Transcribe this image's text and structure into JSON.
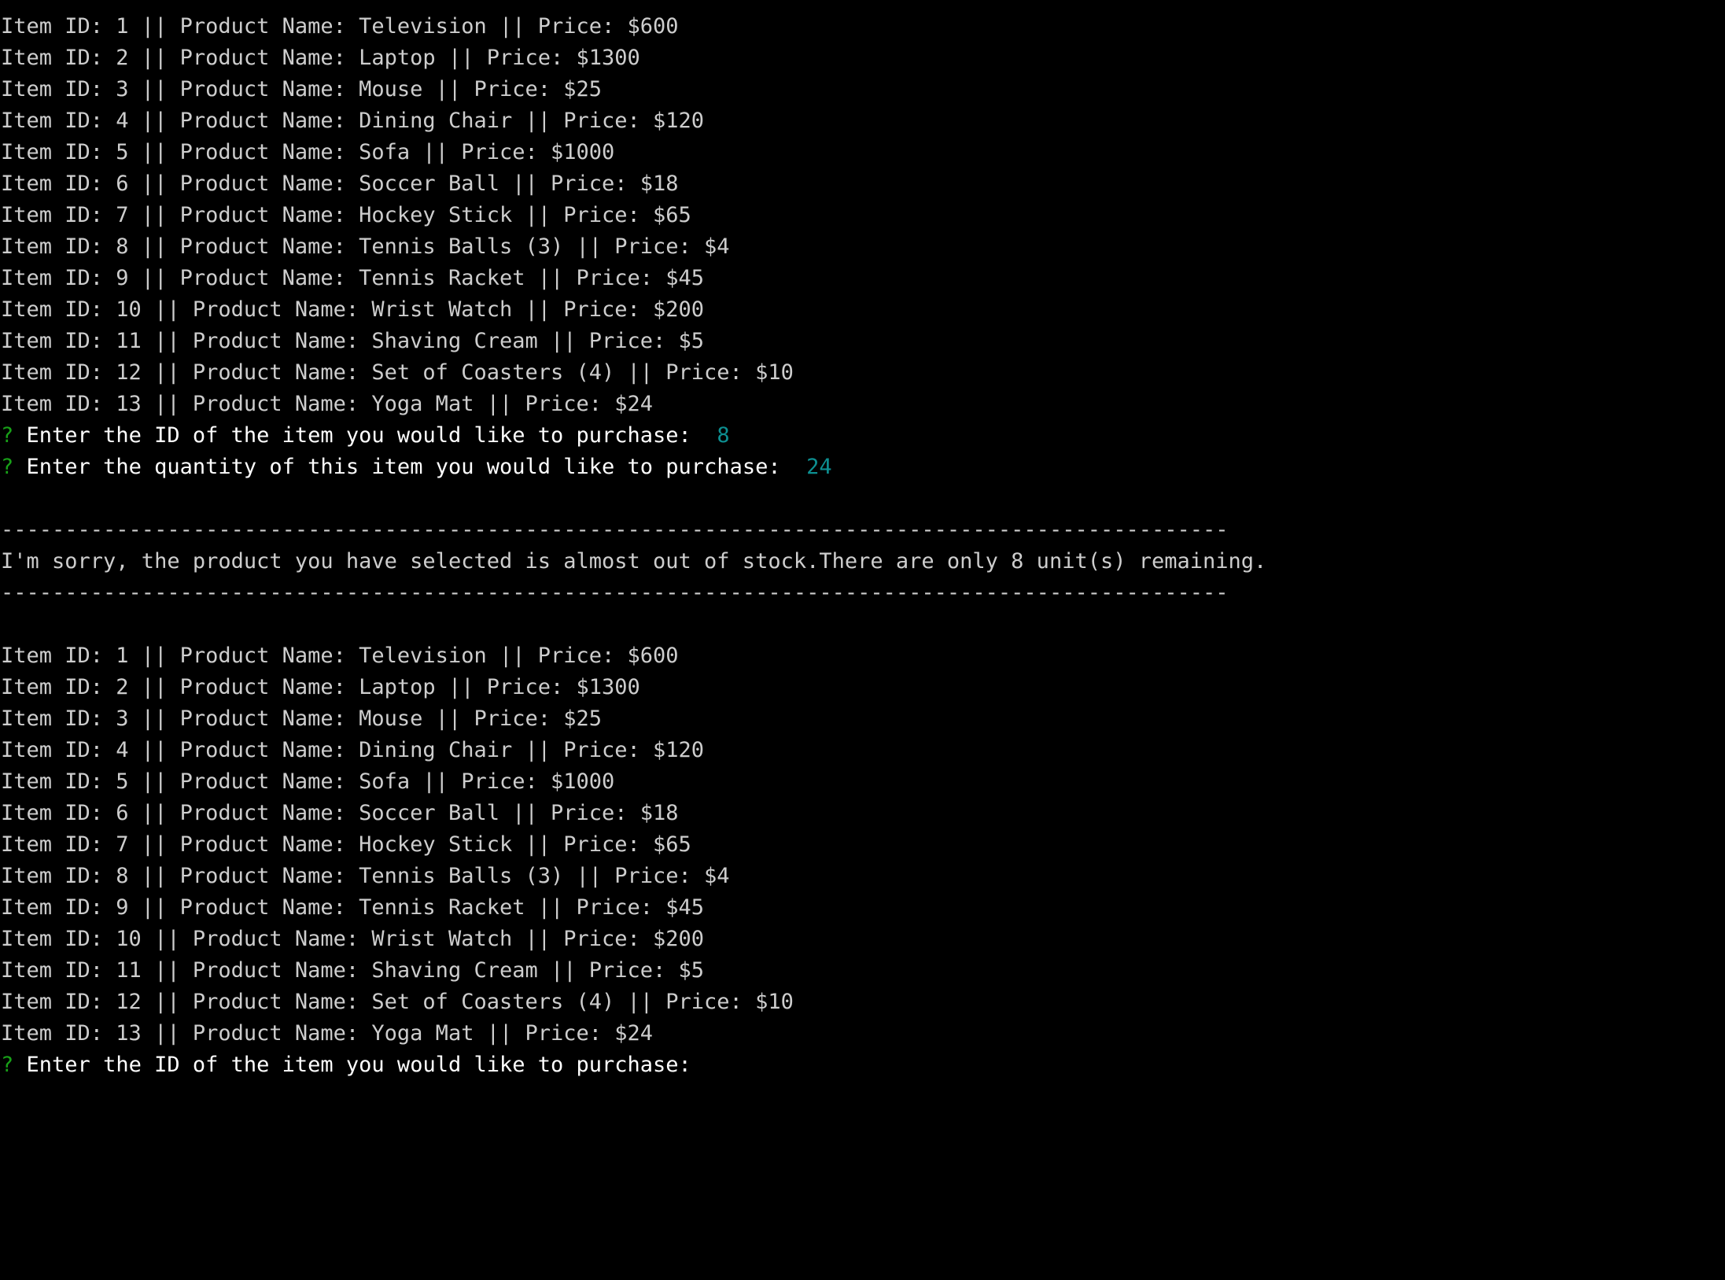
{
  "terminal": {
    "background_color": "#000000",
    "list_text_color": "#cdcdcd",
    "prompt_text_color": "#ffffff",
    "prompt_marker_color": "#18a018",
    "answer_color": "#0d8f91",
    "prompt_marker": "?",
    "separator": "------------------------------------------------------------------------------------------------"
  },
  "catalog": {
    "columns": [
      "Item ID",
      "Product Name",
      "Price"
    ],
    "separator_token": "||",
    "items": [
      {
        "id": "1",
        "name": "Television",
        "price": "$600"
      },
      {
        "id": "2",
        "name": "Laptop",
        "price": "$1300"
      },
      {
        "id": "3",
        "name": "Mouse",
        "price": "$25"
      },
      {
        "id": "4",
        "name": "Dining Chair",
        "price": "$120"
      },
      {
        "id": "5",
        "name": "Sofa",
        "price": "$1000"
      },
      {
        "id": "6",
        "name": "Soccer Ball",
        "price": "$18"
      },
      {
        "id": "7",
        "name": "Hockey Stick",
        "price": "$65"
      },
      {
        "id": "8",
        "name": "Tennis Balls (3)",
        "price": "$4"
      },
      {
        "id": "9",
        "name": "Tennis Racket",
        "price": "$45"
      },
      {
        "id": "10",
        "name": "Wrist Watch",
        "price": "$200"
      },
      {
        "id": "11",
        "name": "Shaving Cream",
        "price": "$5"
      },
      {
        "id": "12",
        "name": "Set of Coasters (4)",
        "price": "$10"
      },
      {
        "id": "13",
        "name": "Yoga Mat",
        "price": "$24"
      }
    ],
    "lines_first_listing": [
      "Item ID: 1 || Product Name: Television || Price: $600",
      "Item ID: 2 || Product Name: Laptop || Price: $1300",
      "Item ID: 3 || Product Name: Mouse || Price: $25",
      "Item ID: 4 || Product Name: Dining Chair || Price: $120",
      "Item ID: 5 || Product Name: Sofa || Price: $1000",
      "Item ID: 6 || Product Name: Soccer Ball || Price: $18",
      "Item ID: 7 || Product Name: Hockey Stick || Price: $65",
      "Item ID: 8 || Product Name: Tennis Balls (3) || Price: $4",
      "Item ID: 9 || Product Name: Tennis Racket || Price: $45",
      "Item ID: 10 || Product Name: Wrist Watch || Price: $200",
      "Item ID: 11 || Product Name: Shaving Cream || Price: $5",
      "Item ID: 12 || Product Name: Set of Coasters (4) || Price: $10",
      "Item ID: 13 || Product Name: Yoga Mat || Price: $24"
    ],
    "lines_second_listing": [
      "Item ID: 1 || Product Name: Television || Price: $600",
      "Item ID: 2 || Product Name: Laptop || Price: $1300",
      "Item ID: 3 || Product Name: Mouse || Price: $25",
      "Item ID: 4 || Product Name: Dining Chair || Price: $120",
      "Item ID: 5 || Product Name: Sofa || Price: $1000",
      "Item ID: 6 || Product Name: Soccer Ball || Price: $18",
      "Item ID: 7 || Product Name: Hockey Stick || Price: $65",
      "Item ID: 8 || Product Name: Tennis Balls (3) || Price: $4",
      "Item ID: 9 || Product Name: Tennis Racket || Price: $45",
      "Item ID: 10 || Product Name: Wrist Watch || Price: $200",
      "Item ID: 11 || Product Name: Shaving Cream || Price: $5",
      "Item ID: 12 || Product Name: Set of Coasters (4) || Price: $10",
      "Item ID: 13 || Product Name: Yoga Mat || Price: $24"
    ]
  },
  "prompts": {
    "item_id_first": {
      "text": "Enter the ID of the item you would like to purchase: ",
      "answer": " 8"
    },
    "quantity_first": {
      "text": "Enter the quantity of this item you would like to purchase: ",
      "answer": " 24"
    },
    "item_id_second": {
      "text": "Enter the ID of the item you would like to purchase:",
      "answer": ""
    }
  },
  "message": {
    "stock_warning": "I'm sorry, the product you have selected is almost out of stock.There are only 8 unit(s) remaining.",
    "units_remaining": "8"
  }
}
